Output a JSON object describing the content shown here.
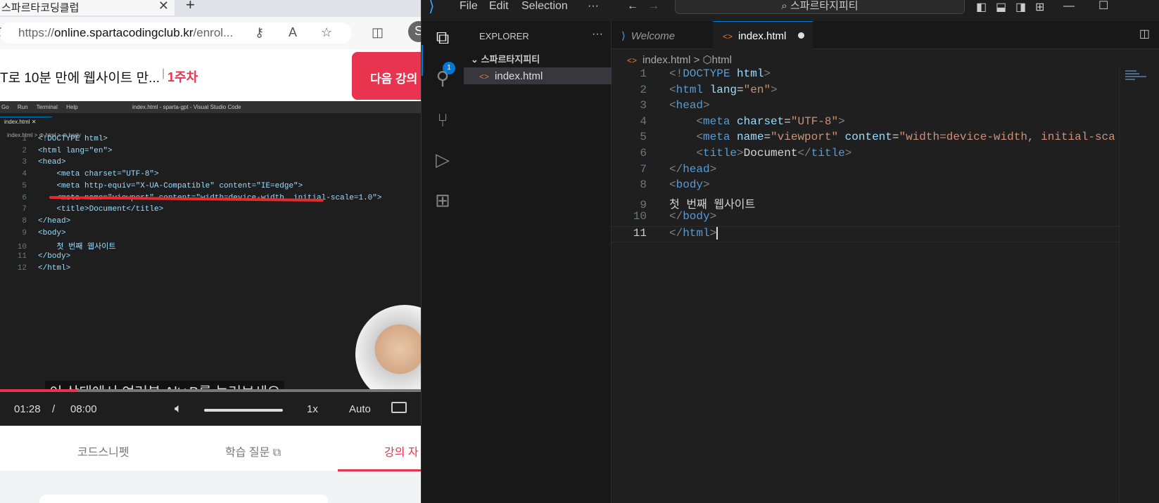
{
  "browser": {
    "tab_title": "스파르타코딩클럽",
    "url_prefix": "https://",
    "url_domain": "online.spartacodingclub.kr",
    "url_path": "/enrol...",
    "course_title": "T로 10분 만에 웹사이트 만...",
    "week_label": "1주차",
    "next_button": "다음 강의",
    "video": {
      "menu": [
        "Go",
        "Run",
        "Terminal",
        "Help"
      ],
      "window_title": "index.html - sparta-gpt - Visual Studio Code",
      "tab": "index.html",
      "breadcrumb": "index.html > ⊛ html > ⊛ body",
      "lines": [
        {
          "n": "1",
          "code": "<!DOCTYPE html>"
        },
        {
          "n": "2",
          "code": "<html lang=\"en\">"
        },
        {
          "n": "3",
          "code": "<head>"
        },
        {
          "n": "4",
          "code": "    <meta charset=\"UTF-8\">"
        },
        {
          "n": "5",
          "code": "    <meta http-equiv=\"X-UA-Compatible\" content=\"IE=edge\">"
        },
        {
          "n": "6",
          "code": "    <meta name=\"viewport\" content=\"width=device-width, initial-scale=1.0\">"
        },
        {
          "n": "7",
          "code": "    <title>Document</title>"
        },
        {
          "n": "8",
          "code": "</head>"
        },
        {
          "n": "9",
          "code": "<body>"
        },
        {
          "n": "10",
          "code": "    첫 번째 웹사이트"
        },
        {
          "n": "11",
          "code": "</body>"
        },
        {
          "n": "12",
          "code": "</html>"
        }
      ],
      "subtitle": "이 상태에서 여러분 Alt+B를 눌러보세요",
      "current_time": "01:28",
      "separator": "/",
      "duration": "08:00",
      "progress_fraction": 0.183,
      "speed": "1x",
      "quality": "Auto"
    },
    "tabs": [
      "코드스니펫",
      "학습 질문",
      "강의 자"
    ],
    "active_tab_index": 2
  },
  "vscode": {
    "menu": [
      "File",
      "Edit",
      "Selection",
      "···"
    ],
    "command_center": "스파르타지피티",
    "explorer": {
      "title": "EXPLORER",
      "more": "···",
      "folder": "스파르타지피티",
      "files": [
        "index.html"
      ]
    },
    "badge": "1",
    "tabs": [
      {
        "label": "Welcome"
      },
      {
        "label": "index.html",
        "dirty": true
      }
    ],
    "breadcrumb": {
      "file": "index.html",
      "sep": ">",
      "node": "html"
    },
    "code": [
      {
        "n": "1",
        "html": "<span class='br'>&lt;!</span><span class='tg'>DOCTYPE</span> <span class='at'>html</span><span class='br'>&gt;</span>"
      },
      {
        "n": "2",
        "html": "<span class='br'>&lt;</span><span class='tg'>html</span> <span class='at'>lang</span>=<span class='st'>\"en\"</span><span class='br'>&gt;</span>"
      },
      {
        "n": "3",
        "html": "<span class='br'>&lt;</span><span class='tg'>head</span><span class='br'>&gt;</span>"
      },
      {
        "n": "4",
        "html": "    <span class='br'>&lt;</span><span class='tg'>meta</span> <span class='at'>charset</span>=<span class='st'>\"UTF-8\"</span><span class='br'>&gt;</span>"
      },
      {
        "n": "5",
        "html": "    <span class='br'>&lt;</span><span class='tg'>meta</span> <span class='at'>name</span>=<span class='st'>\"viewport\"</span> <span class='at'>content</span>=<span class='st'>\"width=device-width, initial-sca</span>"
      },
      {
        "n": "6",
        "html": "    <span class='br'>&lt;</span><span class='tg'>title</span><span class='br'>&gt;</span>Document<span class='br'>&lt;/</span><span class='tg'>title</span><span class='br'>&gt;</span>"
      },
      {
        "n": "7",
        "html": "<span class='br'>&lt;/</span><span class='tg'>head</span><span class='br'>&gt;</span>"
      },
      {
        "n": "8",
        "html": "<span class='br'>&lt;</span><span class='tg'>body</span><span class='br'>&gt;</span>"
      },
      {
        "n": "9",
        "html": "첫 번째 웹사이트"
      },
      {
        "n": "10",
        "html": "<span class='br'>&lt;/</span><span class='tg'>body</span><span class='br'>&gt;</span>"
      },
      {
        "n": "11",
        "html": "<span class='br'>&lt;/</span><span class='tg'>html</span><span class='br'>&gt;</span>"
      }
    ],
    "current_line": "11"
  },
  "colors": {
    "brand_red": "#e8344e",
    "vscode_blue": "#0078d4"
  }
}
